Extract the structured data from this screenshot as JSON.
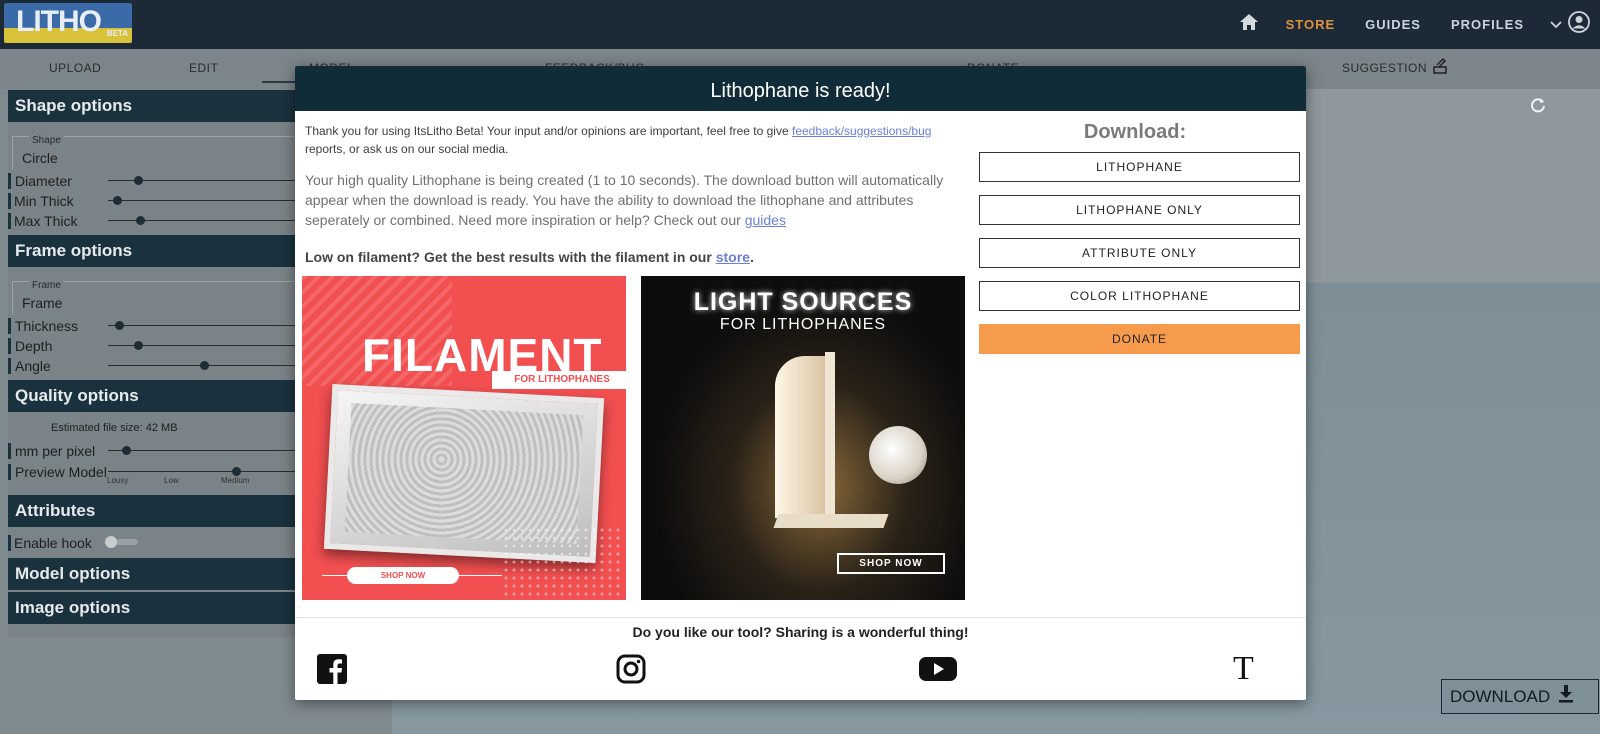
{
  "topbar": {
    "logo_text": "LITHO",
    "logo_badge": "BETA",
    "home_icon": "home-icon",
    "nav": [
      "STORE",
      "GUIDES",
      "PROFILES"
    ],
    "colors": {
      "background": "#1c2a37",
      "active": "#e0913e"
    }
  },
  "tabs": [
    "UPLOAD",
    "EDIT",
    "MODEL",
    "FEEDBACK/BUG",
    "DONATE",
    "SUGGESTION"
  ],
  "panel": {
    "shape_options": "Shape options",
    "shape_label": "Shape",
    "shape_value": "Circle",
    "shape_sliders": [
      {
        "label": "Diameter",
        "value": 0.14
      },
      {
        "label": "Min Thick",
        "value": 0.04
      },
      {
        "label": "Max Thick",
        "value": 0.16
      }
    ],
    "frame_options": "Frame options",
    "frame_label": "Frame",
    "frame_value": "Frame",
    "frame_sliders": [
      {
        "label": "Thickness",
        "value": 0.05
      },
      {
        "label": "Depth",
        "value": 0.15
      },
      {
        "label": "Angle",
        "value": 0.5
      }
    ],
    "quality_options": "Quality options",
    "file_size": "Estimated file size: 42 MB",
    "mm_per_pixel": "mm per pixel",
    "mm_per_pixel_value": 0.1,
    "preview_model": "Preview Model",
    "preview_ticks": [
      "Lousy",
      "Low",
      "Medium"
    ],
    "attributes": "Attributes",
    "enable_hook": "Enable hook",
    "model_options": "Model options",
    "image_options": "Image options"
  },
  "modal": {
    "title": "Lithophane is ready!",
    "intro_1": "Thank you for using ItsLitho Beta! Your input and/or opinions are important, feel free to give",
    "intro_link": "feedback/suggestions/bug",
    "intro_2": "reports, or ask us on our social media.",
    "body_text": "Your high quality Lithophane is being created (1 to 10 seconds). The download button will automatically appear when the download is ready. You have the ability to download the lithophane and attributes seperately or combined. Need more inspiration or help? Check out our",
    "guides_link": "guides",
    "filament_text": "Low on filament? Get the best results with the filament in our",
    "store_link": "store",
    "promo1_title": "FILAMENT",
    "promo1_tag": "FOR LITHOPHANES",
    "promo1_shop": "SHOP NOW",
    "promo2_title": "LIGHT SOURCES",
    "promo2_sub": "FOR LITHOPHANES",
    "promo2_shop": "SHOP NOW",
    "download_heading": "Download:",
    "buttons": [
      "LITHOPHANE",
      "LITHOPHANE ONLY",
      "ATTRIBUTE ONLY",
      "COLOR LITHOPHANE",
      "DONATE"
    ],
    "share_text": "Do you like our tool? Sharing is a wonderful thing!",
    "social": [
      "facebook-icon",
      "instagram-icon",
      "youtube-icon",
      "tiktok-icon"
    ],
    "tiktok_glyph": "T",
    "donate_color": "#f59b4b"
  },
  "viewport": {
    "download_label": "DOWNLOAD"
  }
}
